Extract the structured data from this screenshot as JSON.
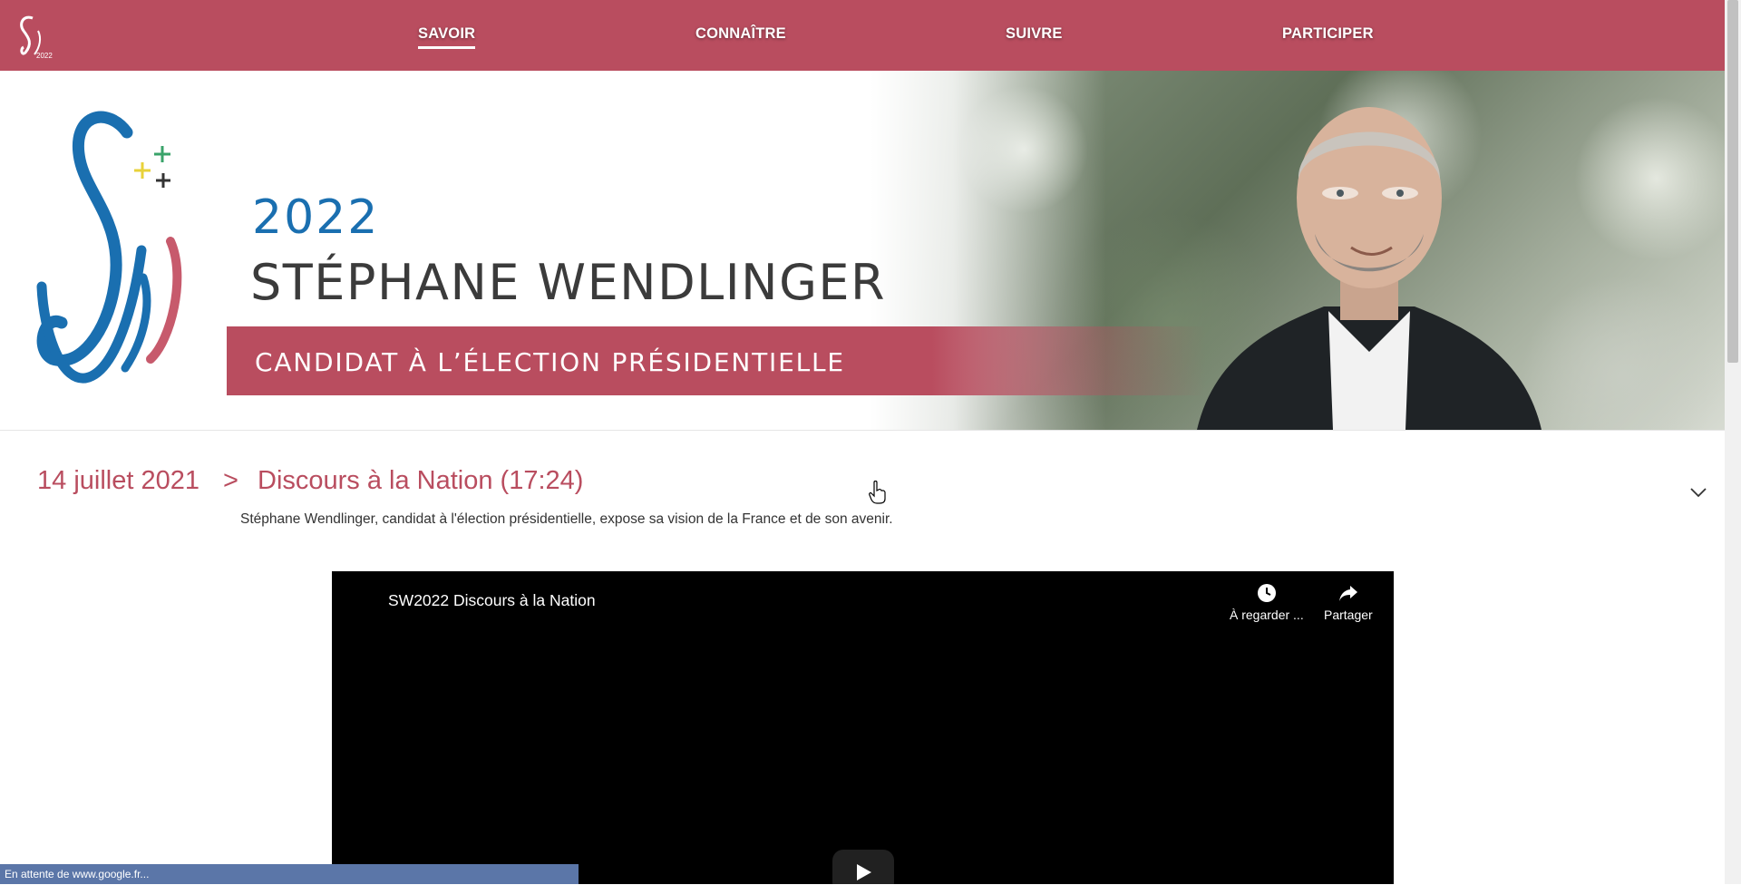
{
  "nav": {
    "items": [
      {
        "label": "SAVOIR",
        "active": true
      },
      {
        "label": "CONNAÎTRE",
        "active": false
      },
      {
        "label": "SUIVRE",
        "active": false
      },
      {
        "label": "PARTICIPER",
        "active": false
      }
    ]
  },
  "hero": {
    "year": "2022",
    "name": "STÉPHANE WENDLINGER",
    "subtitle": "CANDIDAT À L’ÉLECTION PRÉSIDENTIELLE"
  },
  "section": {
    "date": "14 juillet 2021",
    "separator": ">",
    "title": "Discours à la Nation (17:24)",
    "description": "Stéphane Wendlinger, candidat à l'élection présidentielle, expose sa vision de la France et de son avenir."
  },
  "video": {
    "title": "SW2022 Discours à la Nation",
    "watch_later_label": "À regarder ...",
    "share_label": "Partager"
  },
  "status_bar": {
    "text": "En attente de www.google.fr..."
  },
  "colors": {
    "brand": "#b94d5f",
    "blue": "#1a6fb0"
  }
}
